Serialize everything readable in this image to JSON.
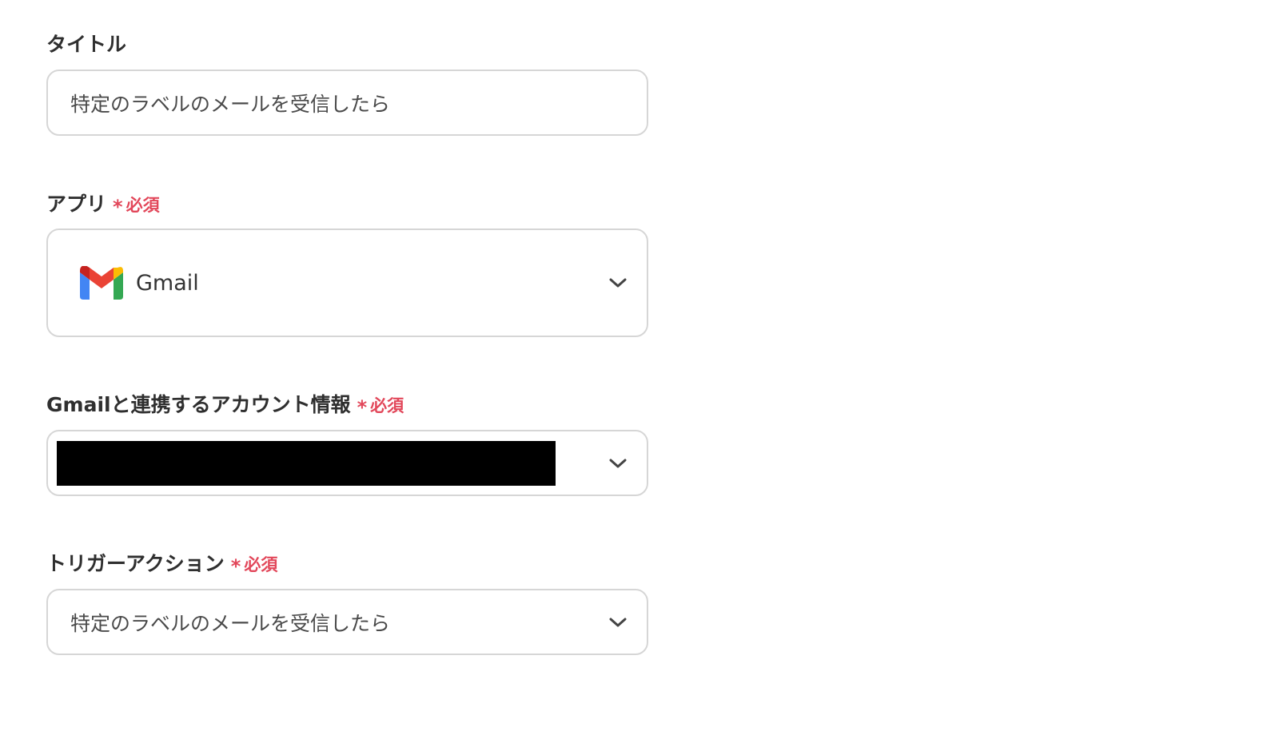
{
  "title_field": {
    "label": "タイトル",
    "value": "特定のラベルのメールを受信したら"
  },
  "app_field": {
    "label": "アプリ",
    "required_mark": "*",
    "required_text": "必須",
    "selected_app": "Gmail",
    "app_icon": "gmail-logo-icon"
  },
  "account_field": {
    "label": "Gmailと連携するアカウント情報",
    "required_mark": "*",
    "required_text": "必須",
    "value_redacted": true
  },
  "trigger_field": {
    "label": "トリガーアクション",
    "required_mark": "*",
    "required_text": "必須",
    "value": "特定のラベルのメールを受信したら"
  },
  "colors": {
    "required": "#e2475a",
    "border": "#d6d6d6",
    "label_text": "#2f2f2f",
    "field_text": "#4a4a4a"
  },
  "icons": {
    "dropdown": "chevron-down-icon"
  }
}
